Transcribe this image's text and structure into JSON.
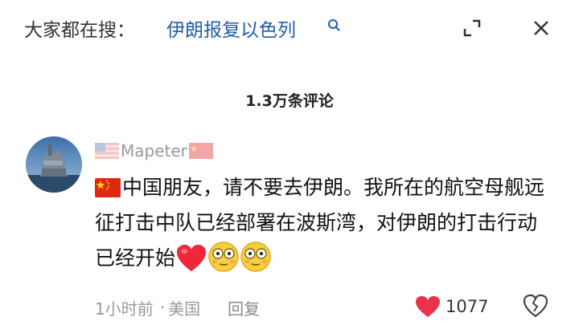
{
  "search_bar": {
    "prefix": "大家都在搜：",
    "query": "伊朗报复以色列"
  },
  "comments_header": {
    "count_label": "1.3万条评论"
  },
  "comment": {
    "username": "Mapeter",
    "text": "中国朋友，请不要去伊朗。我所在的航空母舰远征打击中队已经部署在波斯湾，对伊朗的打击行动已经开始",
    "time": "1小时前",
    "separator": "·",
    "location": "美国",
    "reply_label": "回复",
    "like_count": "1077"
  },
  "icons": {
    "search": "search-icon",
    "minimize": "minimize-icon",
    "close": "close-icon",
    "like": "heart-icon",
    "dislike": "broken-heart-icon"
  },
  "colors": {
    "query": "#1f5fa8",
    "like_heart": "#e8334a",
    "meta": "#999999"
  }
}
